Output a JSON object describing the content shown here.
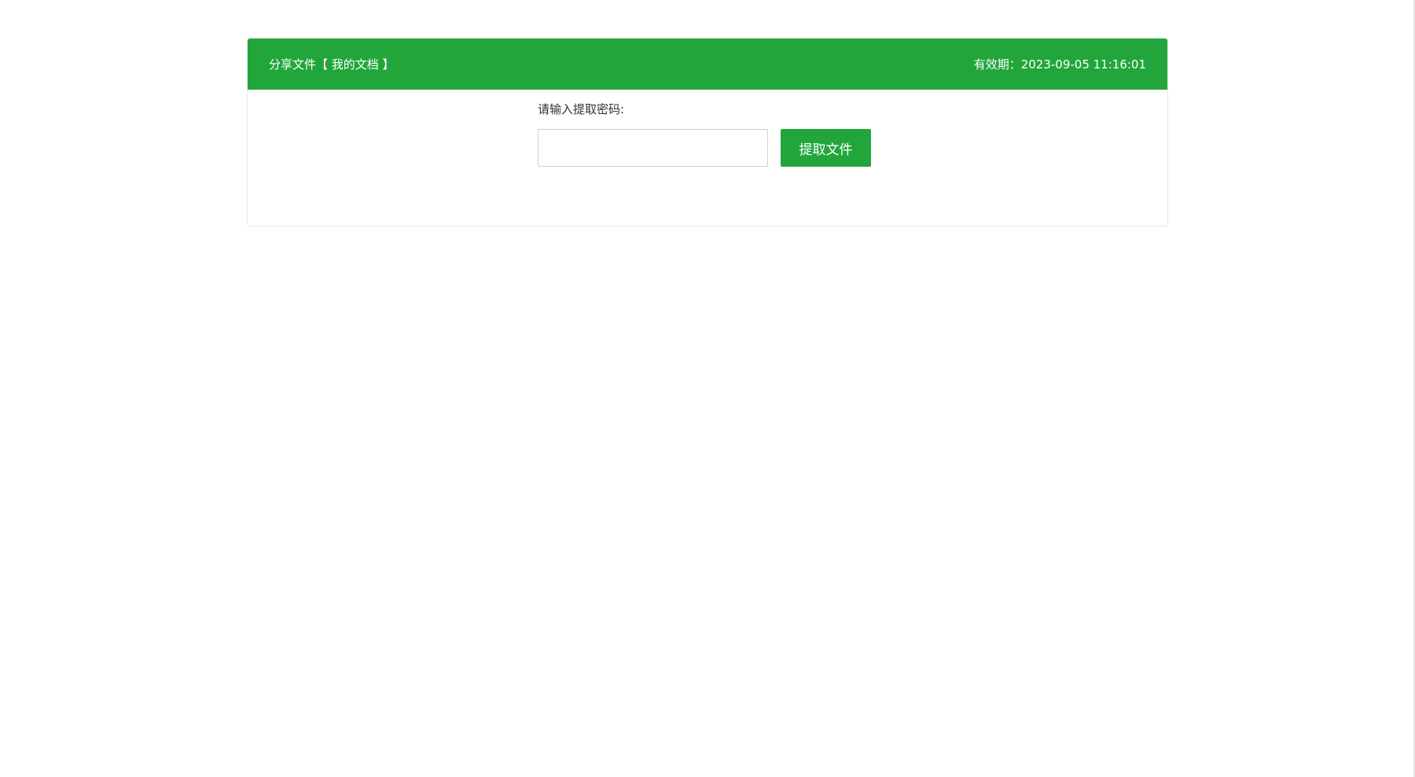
{
  "header": {
    "title": "分享文件【 我的文档 】",
    "expiry": "有效期：2023-09-05 11:16:01"
  },
  "form": {
    "password_label": "请输入提取密码:",
    "password_value": "",
    "password_placeholder": "",
    "submit_label": "提取文件"
  },
  "colors": {
    "accent": "#22a63c",
    "border": "#e8e8e8",
    "text": "#333333"
  }
}
